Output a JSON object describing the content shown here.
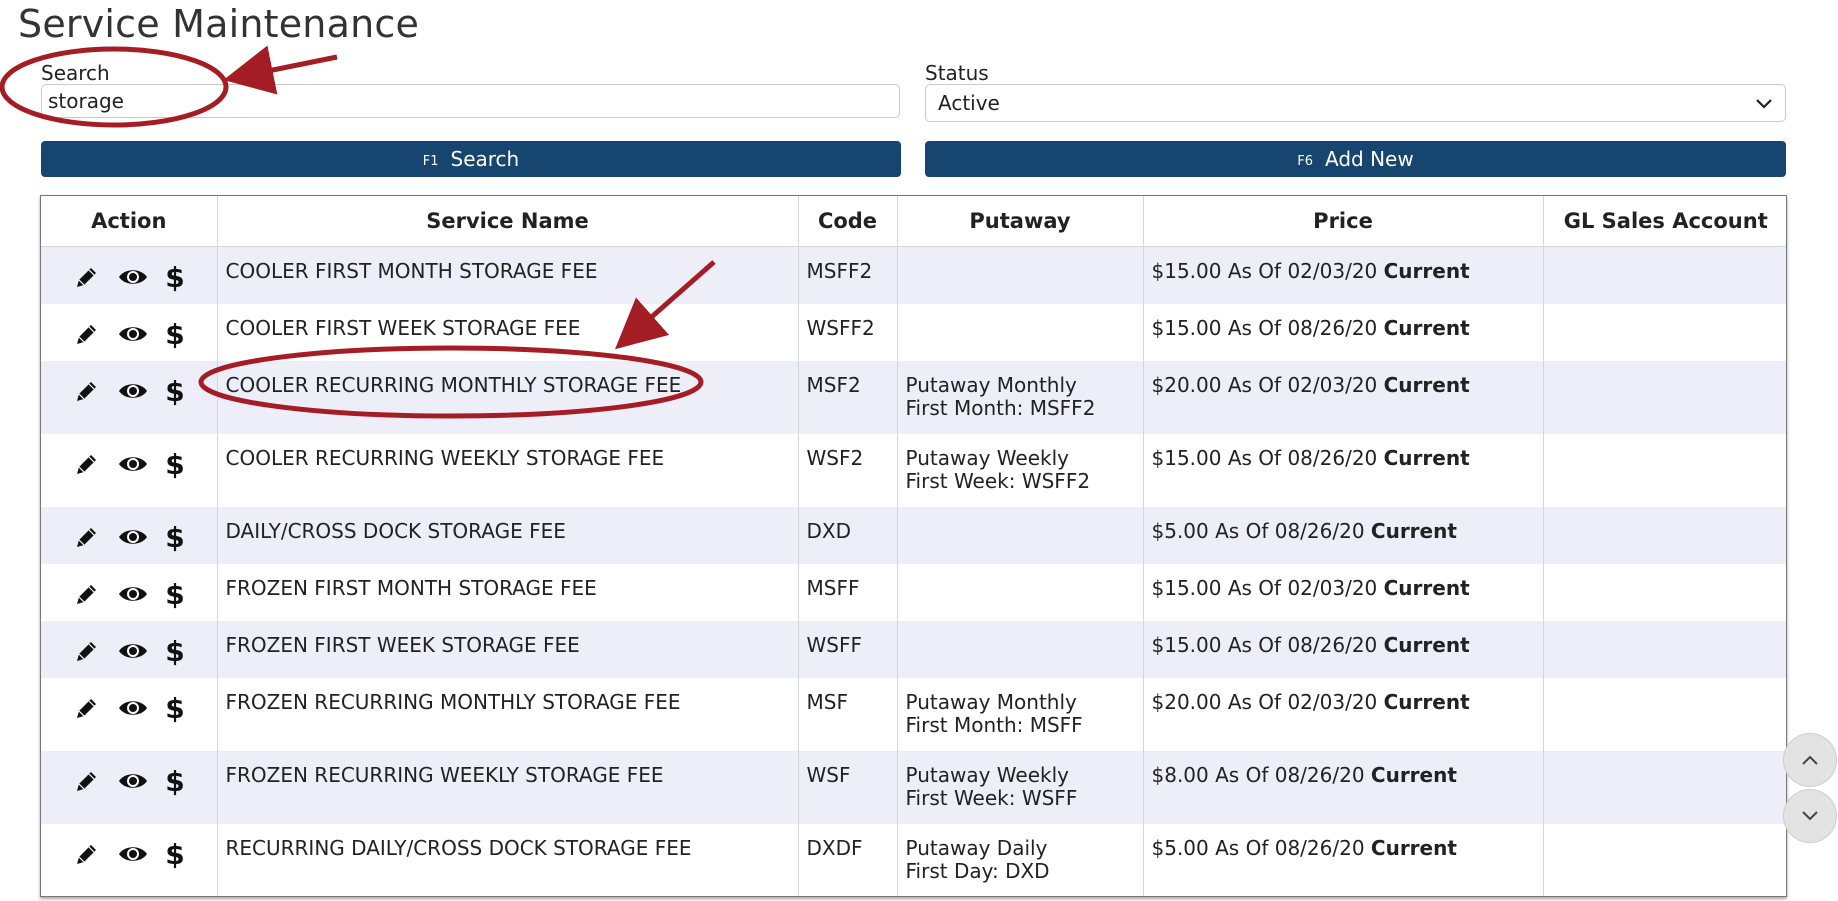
{
  "page": {
    "title": "Service Maintenance"
  },
  "filters": {
    "search_label": "Search",
    "search_value": "storage",
    "status_label": "Status",
    "status_value": "Active"
  },
  "buttons": {
    "search": {
      "key": "F1",
      "label": "Search"
    },
    "add_new": {
      "key": "F6",
      "label": "Add New"
    }
  },
  "table": {
    "columns": [
      "Action",
      "Service Name",
      "Code",
      "Putaway",
      "Price",
      "GL Sales Account"
    ],
    "rows": [
      {
        "name": "COOLER FIRST MONTH STORAGE FEE",
        "code": "MSFF2",
        "putaway1": "",
        "putaway2": "",
        "price": "$15.00 As Of 02/03/20",
        "status": "Current",
        "gl": ""
      },
      {
        "name": "COOLER FIRST WEEK STORAGE FEE",
        "code": "WSFF2",
        "putaway1": "",
        "putaway2": "",
        "price": "$15.00 As Of 08/26/20",
        "status": "Current",
        "gl": ""
      },
      {
        "name": "COOLER RECURRING MONTHLY STORAGE FEE",
        "code": "MSF2",
        "putaway1": "Putaway Monthly",
        "putaway2": "First Month: MSFF2",
        "price": "$20.00 As Of 02/03/20",
        "status": "Current",
        "gl": ""
      },
      {
        "name": "COOLER RECURRING WEEKLY STORAGE FEE",
        "code": "WSF2",
        "putaway1": "Putaway Weekly",
        "putaway2": "First Week: WSFF2",
        "price": "$15.00 As Of 08/26/20",
        "status": "Current",
        "gl": ""
      },
      {
        "name": "DAILY/CROSS DOCK STORAGE FEE",
        "code": "DXD",
        "putaway1": "",
        "putaway2": "",
        "price": "$5.00 As Of 08/26/20",
        "status": "Current",
        "gl": ""
      },
      {
        "name": "FROZEN FIRST MONTH STORAGE FEE",
        "code": "MSFF",
        "putaway1": "",
        "putaway2": "",
        "price": "$15.00 As Of 02/03/20",
        "status": "Current",
        "gl": ""
      },
      {
        "name": "FROZEN FIRST WEEK STORAGE FEE",
        "code": "WSFF",
        "putaway1": "",
        "putaway2": "",
        "price": "$15.00 As Of 08/26/20",
        "status": "Current",
        "gl": ""
      },
      {
        "name": "FROZEN RECURRING MONTHLY STORAGE FEE",
        "code": "MSF",
        "putaway1": "Putaway Monthly",
        "putaway2": "First Month: MSFF",
        "price": "$20.00 As Of 02/03/20",
        "status": "Current",
        "gl": ""
      },
      {
        "name": "FROZEN RECURRING WEEKLY STORAGE FEE",
        "code": "WSF",
        "putaway1": "Putaway Weekly",
        "putaway2": "First Week: WSFF",
        "price": "$8.00 As Of 08/26/20",
        "status": "Current",
        "gl": ""
      },
      {
        "name": "RECURRING DAILY/CROSS DOCK STORAGE FEE",
        "code": "DXDF",
        "putaway1": "Putaway Daily",
        "putaway2": "First Day: DXD",
        "price": "$5.00 As Of 08/26/20",
        "status": "Current",
        "gl": ""
      }
    ],
    "row_action_icons": [
      "pencil-icon",
      "eye-icon",
      "dollar-icon"
    ]
  },
  "scroll_controls": {
    "up_icon": "chevron-up-icon",
    "down_icon": "chevron-down-icon"
  },
  "colors": {
    "primary_button": "#16466f",
    "row_stripe": "#eeeef9",
    "annotation_red": "#a51d24"
  }
}
